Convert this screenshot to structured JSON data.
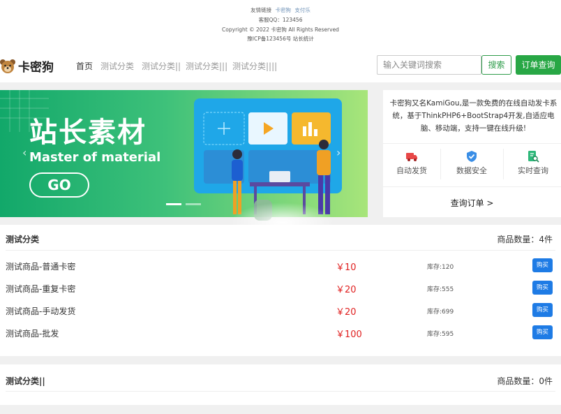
{
  "footer_top": {
    "links_label": "友情链接",
    "links": [
      "卡密狗",
      "支付乐"
    ],
    "qq": "客服QQ：123456",
    "copyright": "Copyright © 2022 卡密狗 All Rights Reserved",
    "icp": "豫ICP备123456号 站长统计"
  },
  "nav": {
    "logo_text": "卡密狗",
    "items": [
      "首页",
      "测试分类",
      "测试分类||",
      "测试分类|||",
      "测试分类||||"
    ],
    "search_placeholder": "输入关键词搜索",
    "search_button": "搜索",
    "order_button": "订单查询"
  },
  "banner": {
    "title": "站长素材",
    "subtitle": "Master of material",
    "go": "GO",
    "prev": "‹",
    "next": "›"
  },
  "info": {
    "description": "卡密狗又名KamiGou,是一款免费的在线自动发卡系统，基于ThinkPHP6+BootStrap4开发,自适应电脑、移动端，支持一键在线升级!",
    "features": [
      "自动发货",
      "数据安全",
      "实时查询"
    ],
    "query_link": "查询订单 >"
  },
  "sections": [
    {
      "title": "测试分类",
      "count": "商品数量：4件",
      "items": [
        {
          "name": "测试商品-普通卡密",
          "price": "￥10",
          "stock": "库存:120",
          "buy": "购买"
        },
        {
          "name": "测试商品-重复卡密",
          "price": "￥20",
          "stock": "库存:555",
          "buy": "购买"
        },
        {
          "name": "测试商品-手动发货",
          "price": "￥20",
          "stock": "库存:699",
          "buy": "购买"
        },
        {
          "name": "测试商品-批发",
          "price": "￥100",
          "stock": "库存:595",
          "buy": "购买"
        }
      ]
    },
    {
      "title": "测试分类||",
      "count": "商品数量：0件",
      "items": []
    }
  ],
  "colors": {
    "accent_green": "#28a745",
    "price_red": "#e02020",
    "buy_blue": "#1e7be5"
  }
}
